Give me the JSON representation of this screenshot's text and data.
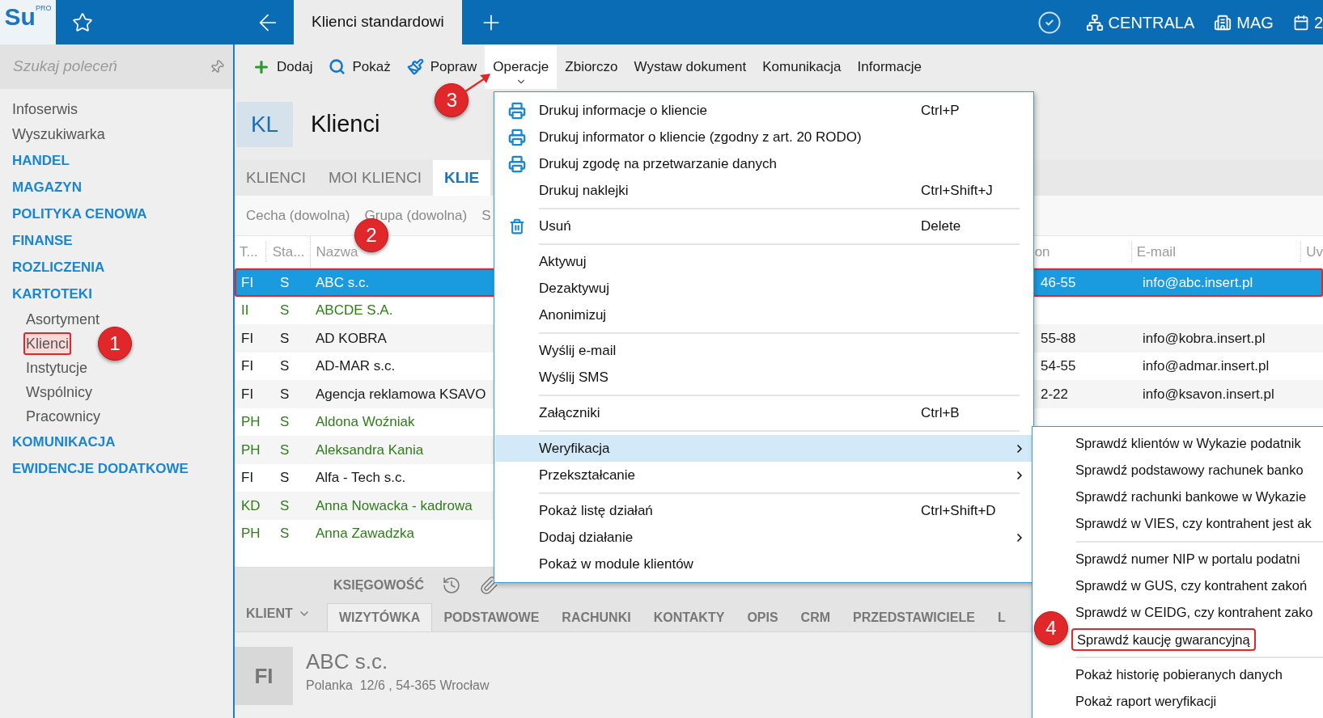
{
  "app_bar": {
    "logo": {
      "text": "Su",
      "superscript": "PRO"
    },
    "tabs": [
      {
        "label": "Klienci standardowi",
        "selected": true
      }
    ],
    "context": [
      {
        "kind": "branch",
        "label": "CENTRALA"
      },
      {
        "kind": "warehouse",
        "label": "MAG"
      },
      {
        "kind": "date",
        "label": "2"
      }
    ]
  },
  "command_search": {
    "placeholder": "Szukaj poleceń"
  },
  "toolbar": [
    {
      "kind": "add",
      "label": "Dodaj",
      "selected": false
    },
    {
      "kind": "show",
      "label": "Pokaż",
      "selected": false
    },
    {
      "kind": "edit",
      "label": "Popraw",
      "selected": false
    },
    {
      "kind": "menu",
      "label": "Operacje",
      "selected": true,
      "callout": "3"
    },
    {
      "kind": "menu",
      "label": "Zbiorczo",
      "selected": false
    },
    {
      "kind": "menu",
      "label": "Wystaw dokument",
      "selected": false
    },
    {
      "kind": "menu",
      "label": "Komunikacja",
      "selected": false
    },
    {
      "kind": "menu",
      "label": "Informacje",
      "selected": false
    }
  ],
  "sidebar": {
    "items": [
      {
        "kind": "link",
        "label": "Infoserwis"
      },
      {
        "kind": "link",
        "label": "Wyszukiwarka"
      },
      {
        "kind": "section",
        "label": "HANDEL"
      },
      {
        "kind": "section",
        "label": "MAGAZYN"
      },
      {
        "kind": "section",
        "label": "POLITYKA CENOWA"
      },
      {
        "kind": "section",
        "label": "FINANSE"
      },
      {
        "kind": "section",
        "label": "ROZLICZENIA"
      },
      {
        "kind": "section",
        "label": "KARTOTEKI",
        "children": [
          {
            "label": "Asortyment",
            "selected": false
          },
          {
            "label": "Klienci",
            "selected": true,
            "callout": "1"
          },
          {
            "label": "Instytucje",
            "selected": false
          },
          {
            "label": "Wspólnicy",
            "selected": false
          },
          {
            "label": "Pracownicy",
            "selected": false
          }
        ]
      },
      {
        "kind": "section",
        "label": "KOMUNIKACJA"
      },
      {
        "kind": "section",
        "label": "EWIDENCJE DODATKOWE"
      }
    ]
  },
  "module": {
    "badge": "KL",
    "title": "Klienci"
  },
  "view_tabs": [
    {
      "label": "KLIENCI",
      "selected": false
    },
    {
      "label": "MOI KLIENCI",
      "selected": false
    },
    {
      "label": "KLIE",
      "selected": true
    }
  ],
  "filters": [
    "Cecha (dowolna)",
    "Grupa (dowolna)",
    "S"
  ],
  "table": {
    "columns": [
      "T...",
      "Sta...",
      "Nazwa"
    ],
    "columns_right": [
      "on",
      "E-mail",
      "Uv"
    ],
    "name_callout": "2",
    "rows": [
      {
        "type": "FI",
        "status": "S",
        "name": "ABC s.c.",
        "phone": "46-55",
        "email": "info@abc.insert.pl",
        "selected": true
      },
      {
        "type": "II",
        "status": "S",
        "name": "ABCDE S.A.",
        "color": "#2e7d1a",
        "selected": false
      },
      {
        "type": "FI",
        "status": "S",
        "name": "AD KOBRA",
        "phone": "55-88",
        "email": "info@kobra.insert.pl",
        "color": "#1a1a1a",
        "selected": false
      },
      {
        "type": "FI",
        "status": "S",
        "name": "AD-MAR s.c.",
        "phone": "54-55",
        "email": "info@admar.insert.pl",
        "color": "#1a1a1a",
        "selected": false
      },
      {
        "type": "FI",
        "status": "S",
        "name": "Agencja reklamowa KSAVO",
        "phone": "2-22",
        "email": "info@ksavon.insert.pl",
        "color": "#1a1a1a",
        "selected": false
      },
      {
        "type": "PH",
        "status": "S",
        "name": "Aldona Woźniak",
        "color": "#2e7d1a",
        "selected": false
      },
      {
        "type": "PH",
        "status": "S",
        "name": "Aleksandra Kania",
        "color": "#2e7d1a",
        "selected": false
      },
      {
        "type": "FI",
        "status": "S",
        "name": "Alfa - Tech s.c.",
        "color": "#1a1a1a",
        "selected": false
      },
      {
        "type": "KD",
        "status": "S",
        "name": "Anna Nowacka - kadrowa",
        "color": "#2e7d1a",
        "selected": false
      },
      {
        "type": "PH",
        "status": "S",
        "name": "Anna Zawadzka",
        "color": "#2e7d1a",
        "selected": false
      }
    ]
  },
  "context_menu": {
    "items": [
      {
        "kind": "print",
        "label": "Drukuj informacje o kliencie",
        "shortcut": "Ctrl+P",
        "has_submenu": false,
        "selected": false
      },
      {
        "kind": "print",
        "label": "Drukuj informator o kliencie (zgodny z art. 20 RODO)",
        "has_submenu": false,
        "selected": false
      },
      {
        "kind": "print",
        "label": "Drukuj zgodę na przetwarzanie danych",
        "has_submenu": false,
        "selected": false
      },
      {
        "kind": "plain",
        "label": "Drukuj naklejki",
        "shortcut": "Ctrl+Shift+J",
        "has_submenu": false,
        "selected": false
      },
      {
        "kind": "separator"
      },
      {
        "kind": "delete",
        "label": "Usuń",
        "shortcut": "Delete",
        "has_submenu": false,
        "selected": false
      },
      {
        "kind": "separator"
      },
      {
        "kind": "plain",
        "label": "Aktywuj",
        "has_submenu": false,
        "selected": false
      },
      {
        "kind": "plain",
        "label": "Dezaktywuj",
        "has_submenu": false,
        "selected": false
      },
      {
        "kind": "plain",
        "label": "Anonimizuj",
        "has_submenu": false,
        "selected": false
      },
      {
        "kind": "separator"
      },
      {
        "kind": "plain",
        "label": "Wyślij e-mail",
        "has_submenu": false,
        "selected": false
      },
      {
        "kind": "plain",
        "label": "Wyślij SMS",
        "has_submenu": false,
        "selected": false
      },
      {
        "kind": "separator"
      },
      {
        "kind": "plain",
        "label": "Załączniki",
        "shortcut": "Ctrl+B",
        "has_submenu": false,
        "selected": false
      },
      {
        "kind": "separator"
      },
      {
        "kind": "plain",
        "label": "Weryfikacja",
        "has_submenu": true,
        "selected": true
      },
      {
        "kind": "plain",
        "label": "Przekształcanie",
        "has_submenu": true,
        "selected": false
      },
      {
        "kind": "separator"
      },
      {
        "kind": "plain",
        "label": "Pokaż listę działań",
        "shortcut": "Ctrl+Shift+D",
        "has_submenu": false,
        "selected": false
      },
      {
        "kind": "plain",
        "label": "Dodaj działanie",
        "has_submenu": true,
        "selected": false
      },
      {
        "kind": "plain",
        "label": "Pokaż w module klientów",
        "has_submenu": false,
        "selected": false
      }
    ]
  },
  "submenu": {
    "items": [
      {
        "kind": "item",
        "label": "Sprawdź klientów w Wykazie podatnik"
      },
      {
        "kind": "item",
        "label": "Sprawdź podstawowy rachunek banko"
      },
      {
        "kind": "item",
        "label": "Sprawdź rachunki bankowe w Wykazie"
      },
      {
        "kind": "item",
        "label": "Sprawdź w VIES, czy kontrahent jest ak"
      },
      {
        "kind": "separator"
      },
      {
        "kind": "item",
        "label": "Sprawdź numer NIP w portalu podatni"
      },
      {
        "kind": "item",
        "label": "Sprawdź w GUS, czy kontrahent zakoń"
      },
      {
        "kind": "item",
        "label": "Sprawdź w CEIDG, czy kontrahent zako"
      },
      {
        "kind": "item",
        "label": "Sprawdź kaucję gwarancyjną",
        "outlined": true,
        "callout": "4"
      },
      {
        "kind": "separator"
      },
      {
        "kind": "item",
        "label": "Pokaż historię pobieranych danych"
      },
      {
        "kind": "item",
        "label": "Pokaż raport weryfikacji"
      }
    ]
  },
  "detail": {
    "section": "KLIENT",
    "group": "KSIĘGOWOŚĆ",
    "tabs": [
      {
        "label": "WIZYTÓWKA",
        "selected": true
      },
      {
        "label": "PODSTAWOWE",
        "selected": false
      },
      {
        "label": "RACHUNKI",
        "selected": false
      },
      {
        "label": "KONTAKTY",
        "selected": false
      },
      {
        "label": "OPIS",
        "selected": false
      },
      {
        "label": "CRM",
        "selected": false
      },
      {
        "label": "PRZEDSTAWICIELE",
        "selected": false
      },
      {
        "label": "L",
        "selected": false
      }
    ],
    "card": {
      "badge": "FI",
      "name": "ABC s.c.",
      "address": "Polanka  12/6 , 54-365 Wrocław"
    }
  }
}
